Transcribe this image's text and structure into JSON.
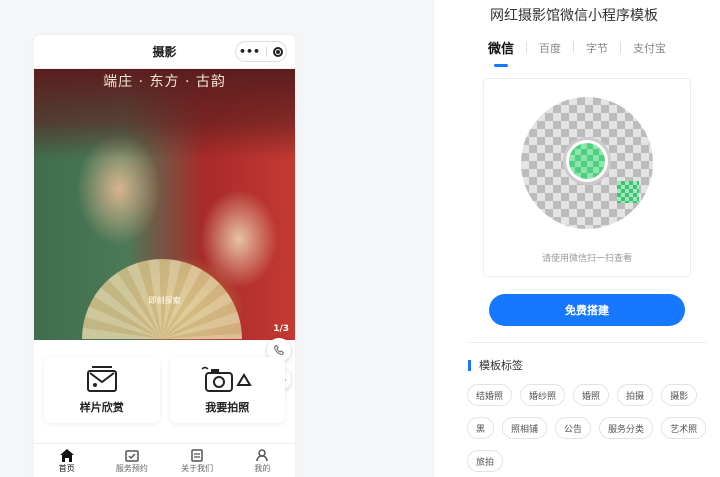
{
  "phone": {
    "header_title": "摄影",
    "capsule_more": "•••",
    "banner_title": "端庄 · 东方 · 古韵",
    "banner_caption": "即刻探索",
    "banner_counter": "1/3",
    "float_phone_icon": "phone-icon",
    "float_chat_icon": "chat-icon",
    "cards": [
      {
        "label": "样片欣赏",
        "icon": "photo-envelope-icon"
      },
      {
        "label": "我要拍照",
        "icon": "camera-icon"
      }
    ],
    "tabbar": [
      {
        "label": "首页",
        "icon": "home-icon",
        "active": true
      },
      {
        "label": "服务预约",
        "icon": "calendar-icon",
        "active": false
      },
      {
        "label": "关于我们",
        "icon": "document-icon",
        "active": false
      },
      {
        "label": "我的",
        "icon": "user-icon",
        "active": false
      }
    ]
  },
  "panel": {
    "title": "网红摄影馆微信小程序模板",
    "platform_tabs": [
      "微信",
      "百度",
      "字节",
      "支付宝"
    ],
    "active_platform": "微信",
    "qr_hint": "请使用微信扫一扫查看",
    "build_button": "免费搭建",
    "tags_title": "模板标签",
    "tags": [
      "结婚照",
      "婚纱照",
      "婚照",
      "拍摄",
      "摄影",
      "黑",
      "照相铺",
      "公告",
      "服务分类",
      "艺术照",
      "旅拍"
    ]
  },
  "colors": {
    "accent": "#1677ff"
  }
}
